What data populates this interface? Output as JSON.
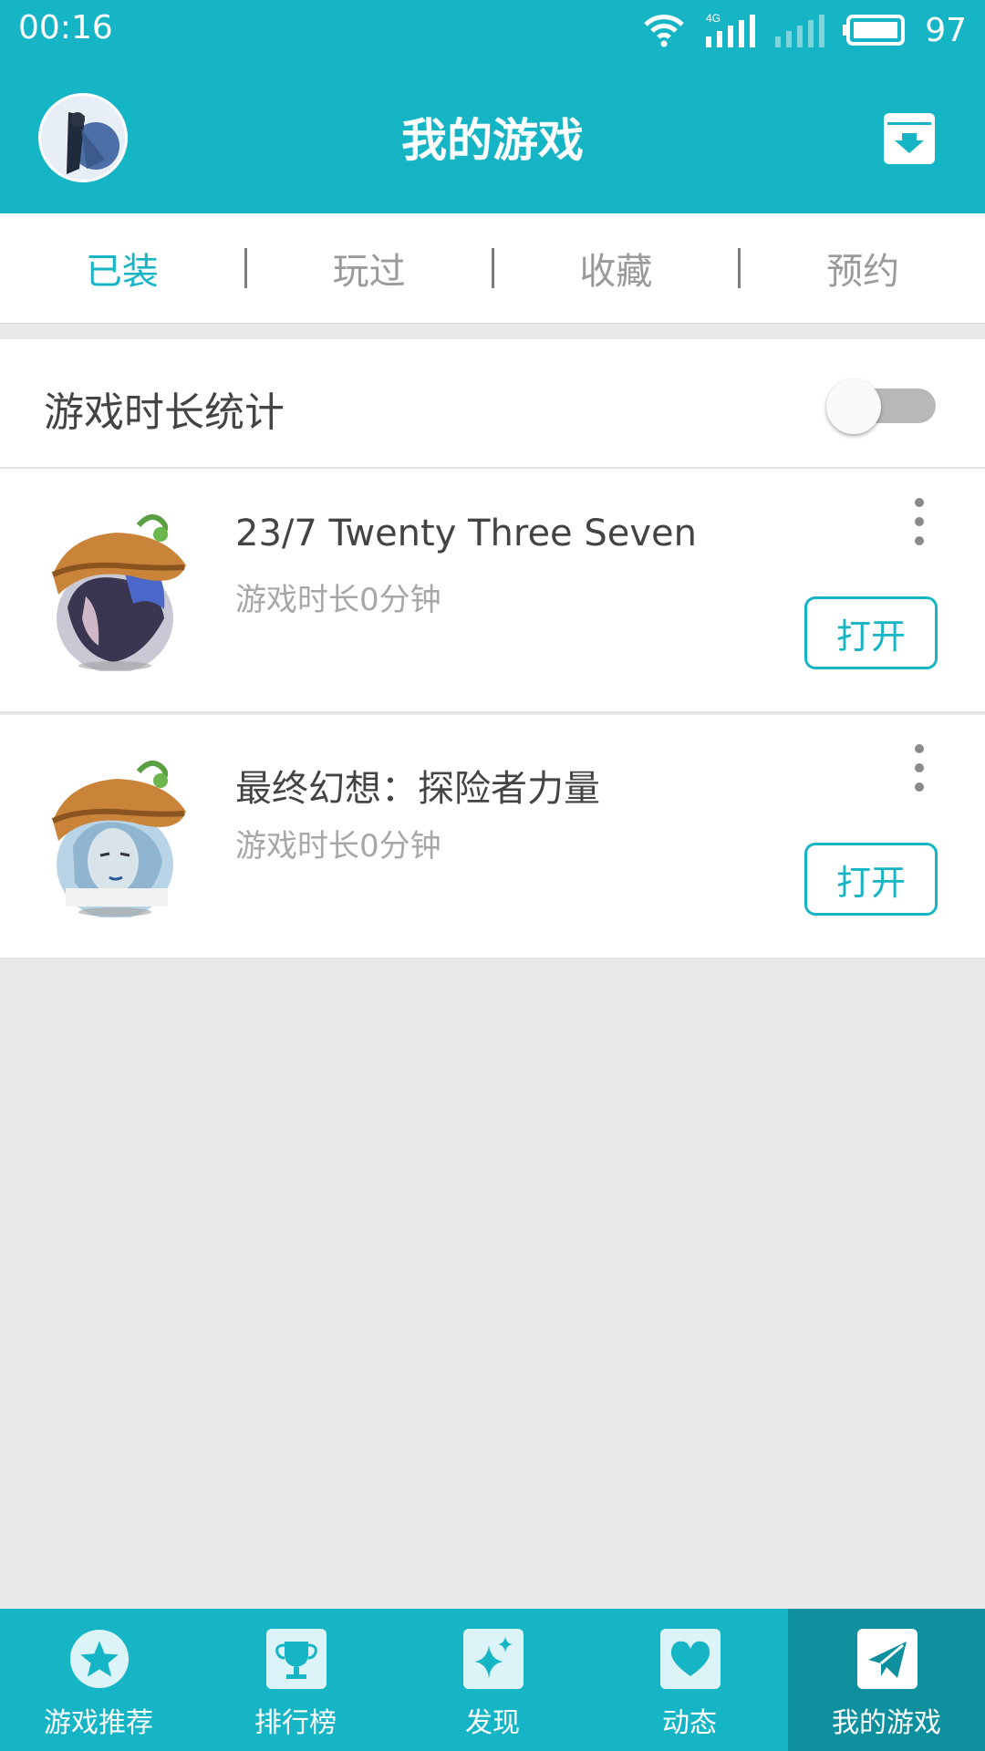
{
  "status_bar": {
    "time": "00:16",
    "network": "4G",
    "battery": "97"
  },
  "header": {
    "title": "我的游戏"
  },
  "tabs": [
    {
      "label": "已装",
      "active": true
    },
    {
      "label": "玩过",
      "active": false
    },
    {
      "label": "收藏",
      "active": false
    },
    {
      "label": "预约",
      "active": false
    }
  ],
  "stat_toggle": {
    "label": "游戏时长统计",
    "enabled": false
  },
  "games": [
    {
      "title": "23/7 Twenty Three Seven",
      "duration": "游戏时长0分钟",
      "action": "打开"
    },
    {
      "title": "最终幻想：探险者力量",
      "duration": "游戏时长0分钟",
      "action": "打开"
    }
  ],
  "bottom_nav": [
    {
      "label": "游戏推荐",
      "icon": "star-icon",
      "active": false
    },
    {
      "label": "排行榜",
      "icon": "trophy-icon",
      "active": false
    },
    {
      "label": "发现",
      "icon": "sparkle-icon",
      "active": false
    },
    {
      "label": "动态",
      "icon": "heart-icon",
      "active": false
    },
    {
      "label": "我的游戏",
      "icon": "paper-plane-icon",
      "active": true
    }
  ],
  "colors": {
    "accent": "#16b5c6",
    "nav_active": "#0f909f",
    "background": "#e9e9e9"
  }
}
